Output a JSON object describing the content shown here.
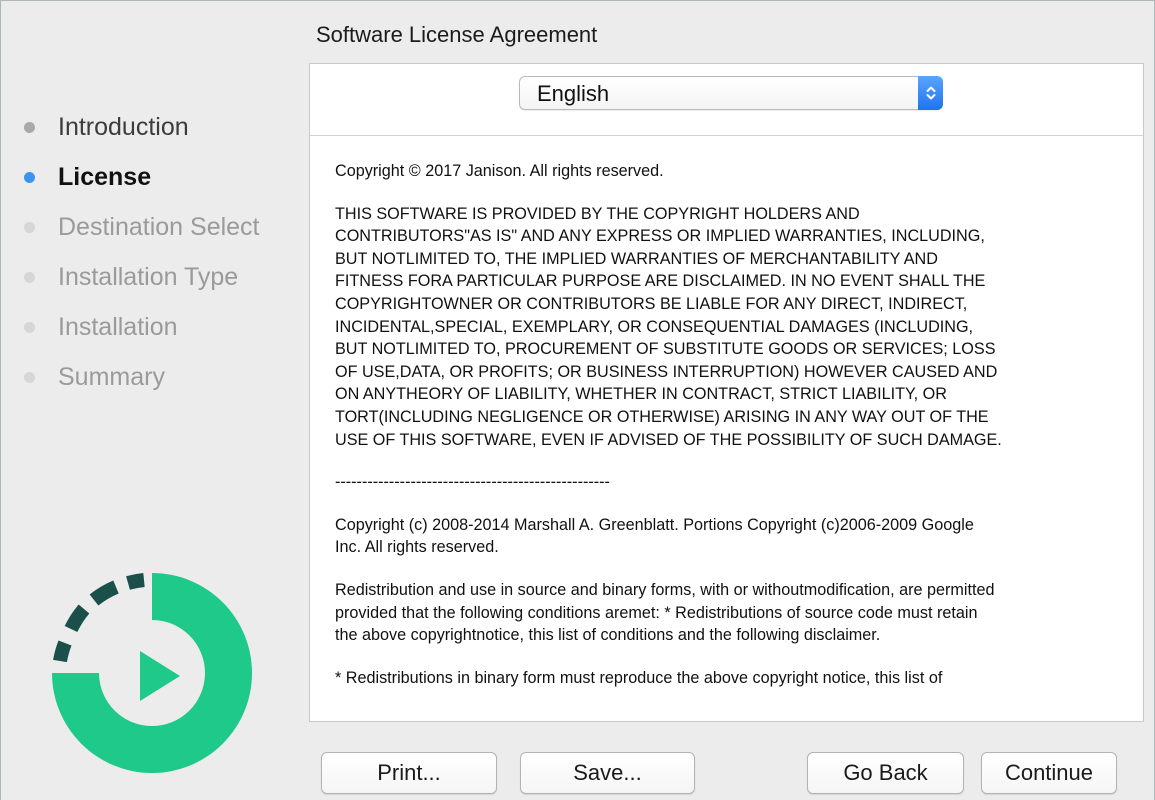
{
  "header": {
    "title": "Software License Agreement"
  },
  "sidebar": {
    "steps": [
      {
        "label": "Introduction",
        "state": "done"
      },
      {
        "label": "License",
        "state": "current"
      },
      {
        "label": "Destination Select",
        "state": "pending"
      },
      {
        "label": "Installation Type",
        "state": "pending"
      },
      {
        "label": "Installation",
        "state": "pending"
      },
      {
        "label": "Summary",
        "state": "pending"
      }
    ],
    "logo_icon": "janison-play-logo",
    "colors": {
      "done_dot": "#a9a9a9",
      "current_dot": "#3d93ef",
      "pending_dot": "#d6d6d6",
      "logo_green": "#1ec98a",
      "logo_dark": "#1b4f4a"
    }
  },
  "language": {
    "value": "English",
    "stepper_icon": "up-down-chevron-icon"
  },
  "license": {
    "paragraphs": [
      "Copyright © 2017 Janison. All rights reserved.",
      "THIS SOFTWARE IS PROVIDED BY THE COPYRIGHT HOLDERS AND\nCONTRIBUTORS\"AS IS\" AND ANY EXPRESS OR IMPLIED WARRANTIES, INCLUDING,\nBUT NOTLIMITED TO, THE IMPLIED WARRANTIES OF MERCHANTABILITY AND\nFITNESS FORA PARTICULAR PURPOSE ARE DISCLAIMED. IN NO EVENT SHALL THE\nCOPYRIGHTOWNER OR CONTRIBUTORS BE LIABLE FOR ANY DIRECT, INDIRECT,\nINCIDENTAL,SPECIAL, EXEMPLARY, OR CONSEQUENTIAL DAMAGES (INCLUDING,\nBUT NOTLIMITED TO, PROCUREMENT OF SUBSTITUTE GOODS OR SERVICES; LOSS\nOF USE,DATA, OR PROFITS; OR BUSINESS INTERRUPTION) HOWEVER CAUSED AND\nON ANYTHEORY OF LIABILITY, WHETHER IN CONTRACT, STRICT LIABILITY, OR\nTORT(INCLUDING NEGLIGENCE OR OTHERWISE) ARISING IN ANY WAY OUT OF THE\nUSE OF THIS SOFTWARE, EVEN IF ADVISED OF THE POSSIBILITY OF SUCH DAMAGE.",
      "---------------------------------------------------",
      "Copyright (c) 2008-2014 Marshall A. Greenblatt. Portions Copyright (c)2006-2009 Google\nInc. All rights reserved.",
      "Redistribution and use in source and binary forms, with or withoutmodification, are permitted\nprovided that the following conditions aremet:   * Redistributions of source code must retain\nthe above copyrightnotice, this list of conditions and the following disclaimer.",
      "   * Redistributions in binary form must reproduce the above copyright notice, this list of"
    ]
  },
  "buttons": {
    "print": "Print...",
    "save": "Save...",
    "go_back": "Go Back",
    "continue": "Continue"
  }
}
